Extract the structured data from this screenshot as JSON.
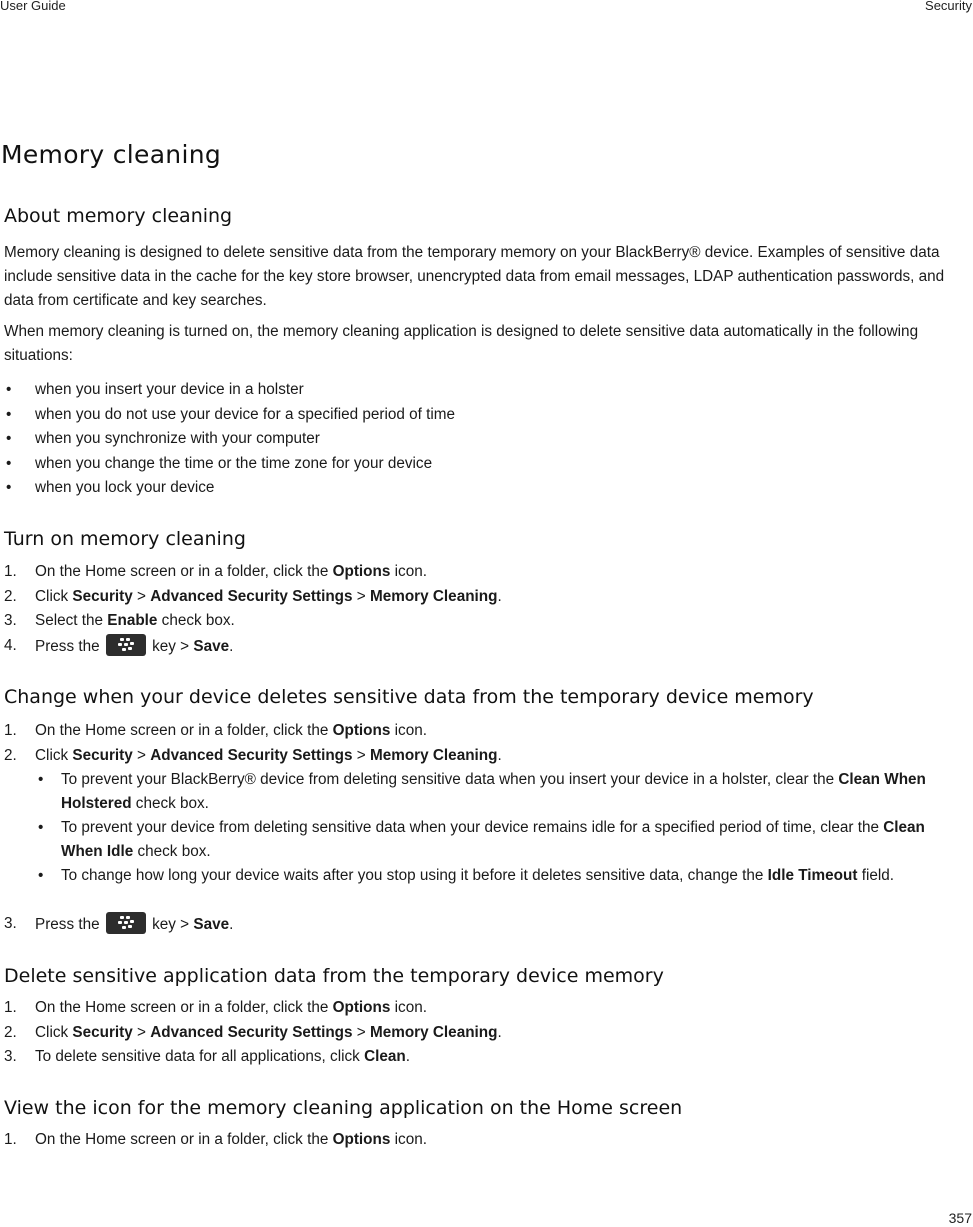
{
  "header": {
    "left": "User Guide",
    "right": "Security"
  },
  "footer": {
    "page_number": "357"
  },
  "title": "Memory cleaning",
  "sections": {
    "about": {
      "heading": "About memory cleaning",
      "para1": "Memory cleaning is designed to delete sensitive data from the temporary memory on your BlackBerry® device. Examples of sensitive data include sensitive data in the cache for the key store browser, unencrypted data from email messages, LDAP authentication passwords, and data from certificate and key searches.",
      "para2": "When memory cleaning is turned on, the memory cleaning application is designed to delete sensitive data automatically in the following situations:",
      "bullet_mark": "•",
      "bullets": [
        "when you insert your device in a holster",
        "when you do not use your device for a specified period of time",
        "when you synchronize with your computer",
        "when you change the time or the time zone for your device",
        "when you lock your device"
      ]
    },
    "turn_on": {
      "heading": "Turn on memory cleaning",
      "steps": [
        {
          "num": "1.",
          "pre": "On the Home screen or in a folder, click the ",
          "b1": "Options",
          "post": " icon."
        },
        {
          "num": "2.",
          "pre": "Click ",
          "b1": "Security",
          "sep1": " > ",
          "b2": "Advanced Security Settings",
          "sep2": " > ",
          "b3": "Memory Cleaning",
          "post": "."
        },
        {
          "num": "3.",
          "pre": "Select the ",
          "b1": "Enable",
          "post": " check box."
        },
        {
          "num": "4.",
          "pre": "Press the ",
          "key_icon": "blackberry-menu-key-icon",
          "mid": " key > ",
          "b1": "Save",
          "post": "."
        }
      ]
    },
    "change_when": {
      "heading": "Change when your device deletes sensitive data from the temporary device memory",
      "steps": [
        {
          "num": "1.",
          "pre": "On the Home screen or in a folder, click the ",
          "b1": "Options",
          "post": " icon."
        },
        {
          "num": "2.",
          "pre": "Click ",
          "b1": "Security",
          "sep1": " > ",
          "b2": "Advanced Security Settings",
          "sep2": " > ",
          "b3": "Memory Cleaning",
          "post": "."
        },
        {
          "num": "3.",
          "pre": "Press the ",
          "key_icon": "blackberry-menu-key-icon",
          "mid": " key > ",
          "b1": "Save",
          "post": "."
        }
      ],
      "sub_bullet_mark": "•",
      "sub_bullets": [
        {
          "pre": "To prevent your BlackBerry® device from deleting sensitive data when you insert your device in a holster, clear the ",
          "b1": "Clean When Holstered",
          "post": " check box."
        },
        {
          "pre": "To prevent your device from deleting sensitive data when your device remains idle for a specified period of time, clear the ",
          "b1": "Clean When Idle",
          "post": " check box."
        },
        {
          "pre": "To change how long your device waits after you stop using it before it deletes sensitive data, change the ",
          "b1": "Idle Timeout",
          "post": " field."
        }
      ]
    },
    "delete_app": {
      "heading": "Delete sensitive application data from the temporary device memory",
      "steps": [
        {
          "num": "1.",
          "pre": "On the Home screen or in a folder, click the ",
          "b1": "Options",
          "post": " icon."
        },
        {
          "num": "2.",
          "pre": "Click ",
          "b1": "Security",
          "sep1": " > ",
          "b2": "Advanced Security Settings",
          "sep2": " > ",
          "b3": "Memory Cleaning",
          "post": "."
        },
        {
          "num": "3.",
          "pre": "To delete sensitive data for all applications, click ",
          "b1": "Clean",
          "post": "."
        }
      ]
    },
    "view_icon": {
      "heading": "View the icon for the memory cleaning application on the Home screen",
      "steps": [
        {
          "num": "1.",
          "pre": "On the Home screen or in a folder, click the ",
          "b1": "Options",
          "post": " icon."
        }
      ]
    }
  }
}
